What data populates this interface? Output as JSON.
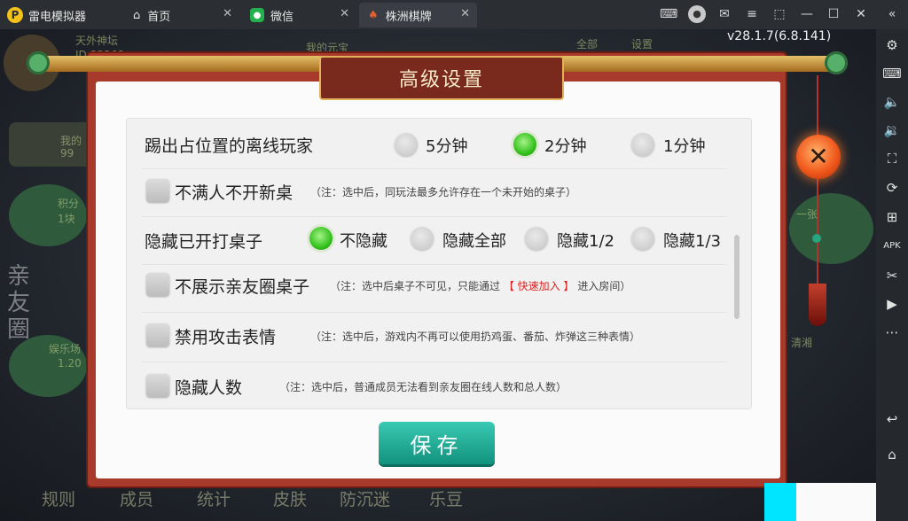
{
  "browser": {
    "tabs": [
      {
        "label": "雷电模拟器",
        "icon": "app-logo-icon"
      },
      {
        "label": "首页",
        "icon": "home-icon"
      },
      {
        "label": "微信",
        "icon": "wechat-icon"
      },
      {
        "label": "株洲棋牌",
        "icon": "game-tab-icon"
      }
    ]
  },
  "game": {
    "version": "v28.1.7(6.8.141)",
    "background_texts": [
      "天外神坛",
      "ID:33368",
      "我的元宝",
      "全部",
      "设置",
      "99",
      "我的",
      "积分",
      "1块",
      "娱乐场",
      "1.20",
      "清湘",
      "一张",
      "亲",
      "友",
      "圈"
    ],
    "bottom_tabs": [
      "规则",
      "成员",
      "统计",
      "皮肤",
      "防沉迷",
      "乐豆"
    ]
  },
  "dialog": {
    "title": "高级设置",
    "settings": [
      {
        "label": "踢出占位置的离线玩家",
        "type": "radio",
        "options": [
          {
            "label": "5分钟",
            "selected": false
          },
          {
            "label": "2分钟",
            "selected": true
          },
          {
            "label": "1分钟",
            "selected": false
          }
        ]
      },
      {
        "label": "不满人不开新桌",
        "type": "checkbox",
        "checked": false,
        "note": "（注：选中后，同玩法最多允许存在一个未开始的桌子）"
      },
      {
        "label": "隐藏已开打桌子",
        "type": "radio",
        "options": [
          {
            "label": "不隐藏",
            "selected": true
          },
          {
            "label": "隐藏全部",
            "selected": false
          },
          {
            "label": "隐藏1/2",
            "selected": false
          },
          {
            "label": "隐藏1/3",
            "selected": false
          }
        ]
      },
      {
        "label": "不展示亲友圈桌子",
        "type": "checkbox",
        "checked": false,
        "note_prefix": "（注：选中后桌子不可见，只能通过",
        "note_highlight": "【 快速加入 】",
        "note_suffix": "进入房间）"
      },
      {
        "label": "禁用攻击表情",
        "type": "checkbox",
        "checked": false,
        "note": "（注：选中后，游戏内不再可以使用扔鸡蛋、番茄、炸弹这三种表情）"
      },
      {
        "label": "隐藏人数",
        "type": "checkbox",
        "checked": false,
        "note": "（注：选中后，普通成员无法看到亲友圈在线人数和总人数）"
      }
    ],
    "save_label": "保存",
    "close_label": "✕"
  },
  "colors": {
    "selected_radio": "#34c21d",
    "save_button": "#1ba893",
    "frame": "#a73a2a",
    "highlight_note": "#dd2222"
  }
}
